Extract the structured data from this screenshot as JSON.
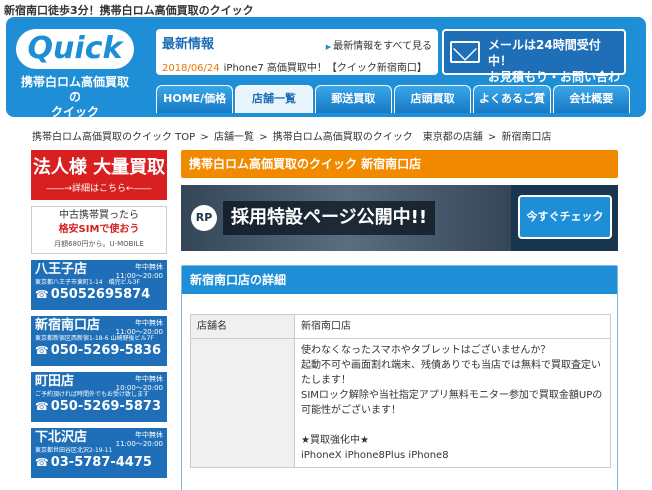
{
  "topline": "新宿南口徒歩3分！携帯白ロム高価買取のクイック",
  "logo": {
    "word": "Quick",
    "tag_line1": "携帯白ロム高価買取の",
    "tag_line2": "クイック"
  },
  "news": {
    "title": "最新情報",
    "all_link": "最新情報をすべて見る",
    "date": "2018/06/24",
    "text": "iPhone7 高価買取中！【クイック新宿南口】"
  },
  "mail": {
    "line1": "メールは24時間受付中！",
    "line2": "お見積もり・お問い合わせ"
  },
  "nav": [
    {
      "label": "HOME/価格"
    },
    {
      "label": "店舗一覧"
    },
    {
      "label": "郵送買取"
    },
    {
      "label": "店頭買取"
    },
    {
      "label": "よくあるご質問"
    },
    {
      "label": "会社概要"
    }
  ],
  "breadcrumb": {
    "items": [
      "携帯白ロム高価買取のクイック TOP",
      "店舗一覧",
      "携帯白ロム高価買取のクイック　東京都の店舗",
      "新宿南口店"
    ],
    "sep": ">"
  },
  "sidebar": {
    "corp": {
      "big": "法人様 大量買取",
      "small": "――→詳細はこちら←――"
    },
    "sim": {
      "line1": "中古携帯買ったら",
      "line2": "格安SIMで使おう",
      "line3": "月額680円から。U-MOBILE"
    },
    "shops": [
      {
        "name": "八王子店",
        "hours1": "年中無休",
        "hours2": "11:00～20:00",
        "addr": "東京都八王子市東町1-14　橋完ビル3F",
        "tel": "05052695874"
      },
      {
        "name": "新宿南口店",
        "hours1": "年中無休",
        "hours2": "11:00～20:00",
        "addr": "東京都新宿区西新宿1-18-6 山崎野後ビル7F",
        "tel": "050-5269-5836"
      },
      {
        "name": "町田店",
        "hours1": "年中無休",
        "hours2": "10:00～20:00",
        "addr": "ご予約頂ければ時間外でもお受け致します",
        "tel": "050-5269-5873"
      },
      {
        "name": "下北沢店",
        "hours1": "年中無休",
        "hours2": "11:00～20:00",
        "addr": "東京都世田谷区北沢2-19-11",
        "tel": "03-5787-4475"
      }
    ]
  },
  "main": {
    "shop_title": "携帯白ロム高価買取のクイック 新宿南口店",
    "recruit": {
      "logo": "RP",
      "text": "採用特設ページ公開中!!",
      "button": "今すぐチェック"
    },
    "detail_title": "新宿南口店の詳細",
    "table": {
      "row1": {
        "key": "店舗名",
        "value": "新宿南口店"
      },
      "row2": {
        "key": "",
        "lines": [
          "使わなくなったスマホやタブレットはございませんか？",
          "起動不可や画面割れ端末、残債ありでも当店では無料で買取査定いたします！",
          "SIMロック解除や当社指定アプリ無料モニター参加で買取金額UPの可能性がございます！",
          "",
          "★買取強化中★",
          "iPhoneX iPhone8Plus iPhone8"
        ]
      }
    }
  }
}
